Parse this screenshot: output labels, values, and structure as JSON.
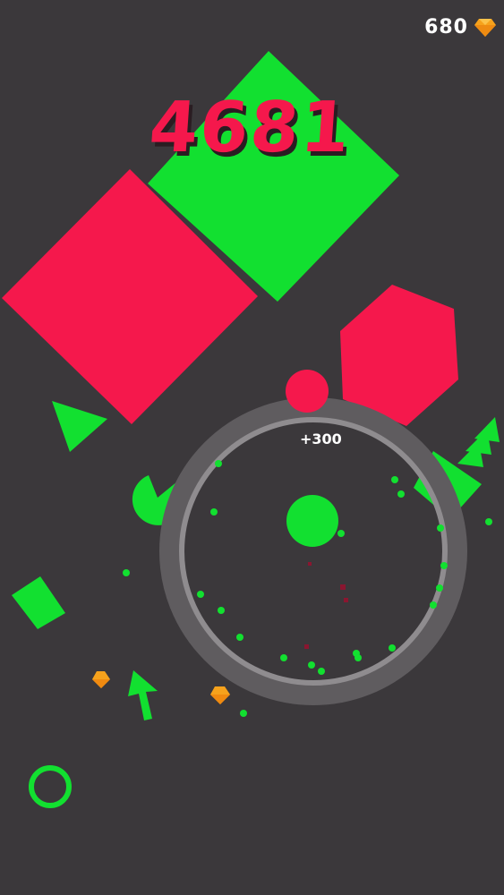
{
  "hud": {
    "gem_count": "680",
    "score": "4681",
    "bonus_popup": "+300"
  },
  "colors": {
    "background": "#3b383b",
    "green": "#12e030",
    "red": "#f5184c",
    "ring": "#7a777a",
    "gem": "#f6a21c"
  },
  "icons": [
    "gem-icon",
    "arrow-up-icon",
    "tree-icon",
    "pacman-icon"
  ]
}
